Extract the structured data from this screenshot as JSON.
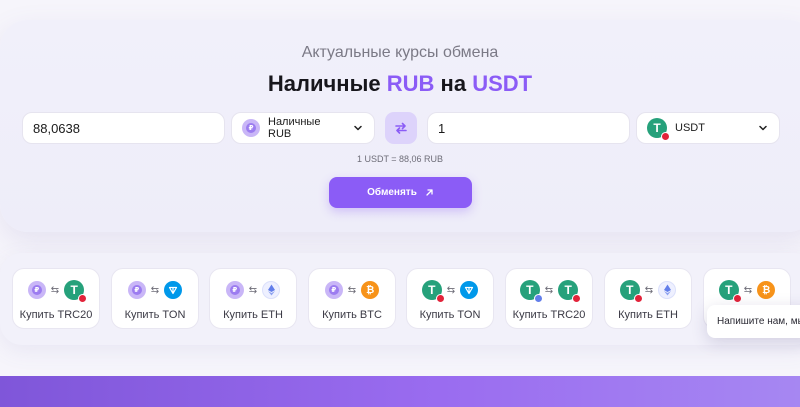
{
  "exchange": {
    "subtitle": "Актуальные курсы обмена",
    "title_prefix": "Наличные",
    "title_from": "RUB",
    "title_middle": "на",
    "title_to": "USDT",
    "from_amount": "88,0638",
    "from_currency": "Наличные RUB",
    "to_amount": "1",
    "to_currency": "USDT",
    "rate_text": "1 USDT = 88,06 RUB",
    "submit_label": "Обменять"
  },
  "quick_pairs": [
    {
      "from_icon": "rub-coin-icon",
      "to_icon": "usdt-trc20-icon",
      "label": "Купить TRC20"
    },
    {
      "from_icon": "rub-coin-icon",
      "to_icon": "ton-icon",
      "label": "Купить TON"
    },
    {
      "from_icon": "rub-coin-icon",
      "to_icon": "eth-icon",
      "label": "Купить ETH"
    },
    {
      "from_icon": "rub-coin-icon",
      "to_icon": "btc-icon",
      "label": "Купить BTC"
    },
    {
      "from_icon": "usdt-trc20-icon",
      "to_icon": "ton-icon",
      "label": "Купить TON"
    },
    {
      "from_icon": "usdt-erc20-icon",
      "to_icon": "usdt-trc20-icon",
      "label": "Купить TRC20"
    },
    {
      "from_icon": "usdt-trc20-icon",
      "to_icon": "eth-icon",
      "label": "Купить ETH"
    },
    {
      "from_icon": "usdt-trc20-icon",
      "to_icon": "btc-icon",
      "label": ""
    }
  ],
  "chat_tooltip": "Напишите нам, мы",
  "colors": {
    "accent": "#8b5cf6",
    "tether": "#26a17b",
    "ton": "#0098ea",
    "btc": "#f7931a",
    "eth": "#627eea"
  }
}
